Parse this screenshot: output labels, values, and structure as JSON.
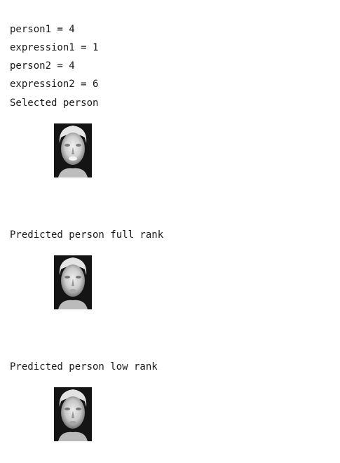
{
  "output": {
    "lines": [
      "person1 = 4",
      "expression1 = 1",
      "person2 = 4",
      "expression2 = 6",
      "Selected person"
    ],
    "full_rank_heading": "Predicted person full rank",
    "low_rank_heading": "Predicted person low rank"
  },
  "images": {
    "selected": "face-image-selected",
    "full_rank": "face-image-full-rank",
    "low_rank": "face-image-low-rank"
  }
}
